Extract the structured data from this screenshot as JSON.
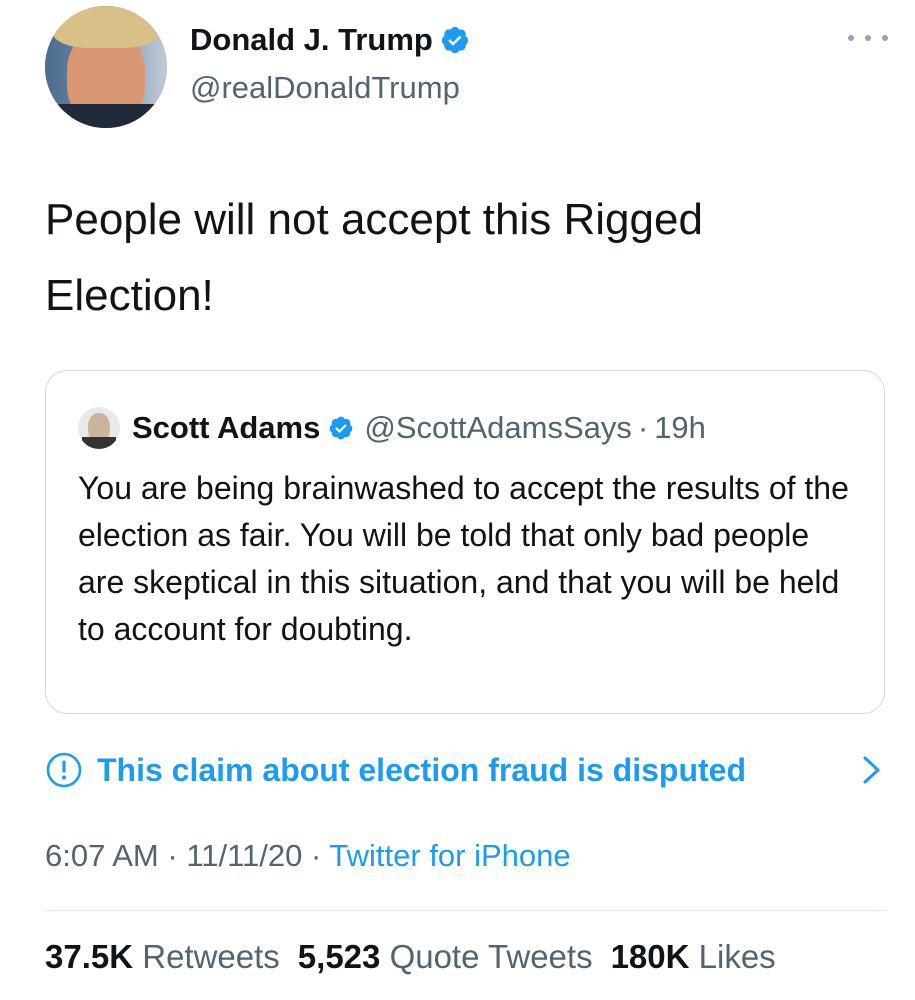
{
  "author": {
    "name": "Donald J. Trump",
    "handle": "@realDonaldTrump",
    "verified_icon": "verified-badge-icon",
    "more_icon": "more-options-icon"
  },
  "tweet": {
    "text": "People will not accept this Rigged Election!"
  },
  "quoted_tweet": {
    "name": "Scott Adams",
    "handle": "@ScottAdamsSays",
    "separator": "·",
    "time": "19h",
    "text": "You are being brainwashed to accept the results of the election as fair. You will be told that only bad people are skeptical in this situation, and that you will be held to account for doubting."
  },
  "notice": {
    "text": "This claim about election fraud is disputed",
    "icon": "info-exclamation-icon",
    "chevron": "chevron-right-icon"
  },
  "meta": {
    "time": "6:07 AM",
    "separator": "·",
    "date": "11/11/20",
    "source": "Twitter for iPhone"
  },
  "stats": {
    "retweets_count": "37.5K",
    "retweets_label": "Retweets",
    "quotes_count": "5,523",
    "quotes_label": "Quote Tweets",
    "likes_count": "180K",
    "likes_label": "Likes"
  },
  "colors": {
    "accent": "#1d9bf0",
    "secondary_text": "#536471",
    "primary_text": "#0f1419",
    "border": "#cfd9de"
  }
}
